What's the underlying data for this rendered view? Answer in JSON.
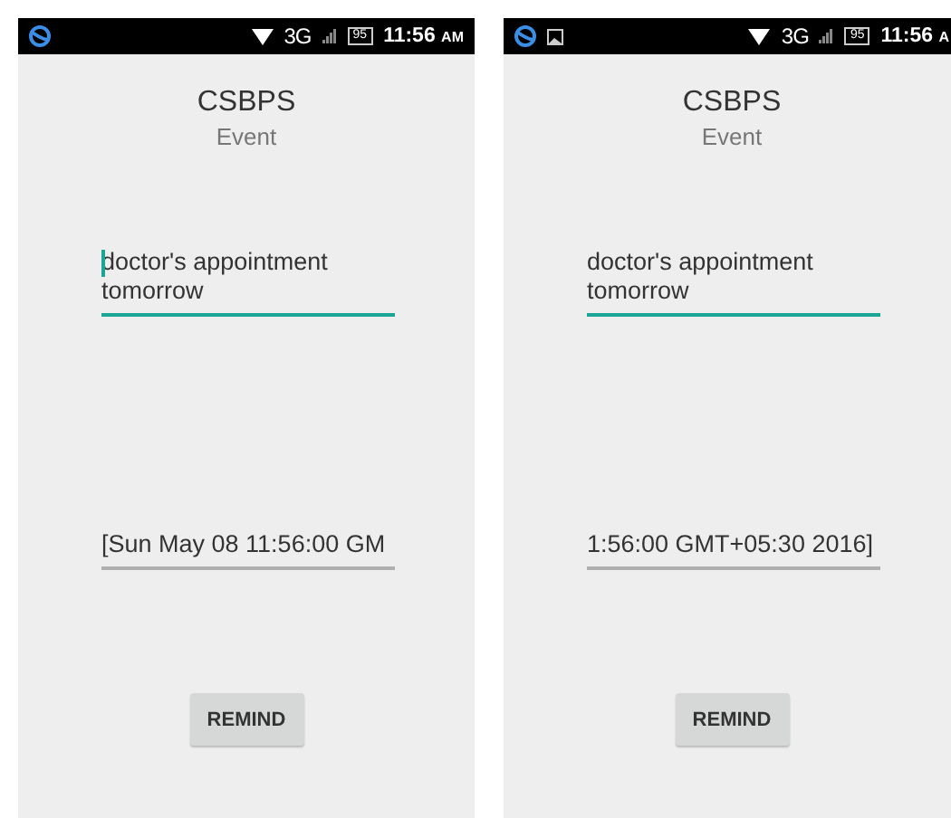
{
  "screens": [
    {
      "status_bar": {
        "extra_icon": false,
        "network": "3G",
        "battery": "95",
        "time": "11:56",
        "time_suffix": "AM"
      },
      "title": "CSBPS",
      "subtitle": "Event",
      "event_field": {
        "value": "doctor's appointment tomorrow",
        "focused": true
      },
      "date_field": {
        "value": "[Sun May 08 11:56:00 GM"
      },
      "remind_button": "REMIND"
    },
    {
      "status_bar": {
        "extra_icon": true,
        "network": "3G",
        "battery": "95",
        "time": "11:56",
        "time_suffix": "A"
      },
      "title": "CSBPS",
      "subtitle": "Event",
      "event_field": {
        "value": "doctor's appointment tomorrow",
        "focused": false
      },
      "date_field": {
        "value": "1:56:00 GMT+05:30 2016]"
      },
      "remind_button": "REMIND"
    }
  ]
}
